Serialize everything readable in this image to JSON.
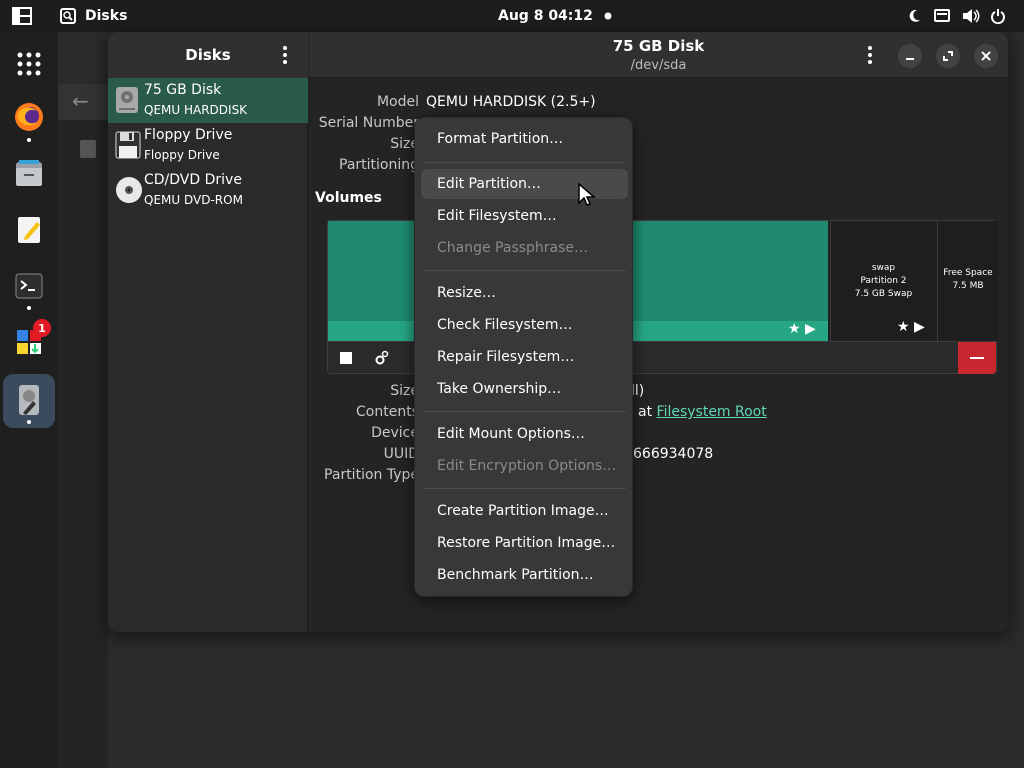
{
  "topbar": {
    "app_name": "Disks",
    "clock": "Aug 8  04:12"
  },
  "dock": {
    "store_badge_count": "1"
  },
  "window": {
    "sidebar": {
      "title": "Disks",
      "drives": [
        {
          "name": "75 GB Disk",
          "sub": "QEMU HARDDISK"
        },
        {
          "name": "Floppy Drive",
          "sub": "Floppy Drive"
        },
        {
          "name": "CD/DVD Drive",
          "sub": "QEMU DVD-ROM"
        }
      ]
    },
    "header": {
      "title": "75 GB Disk",
      "subtitle": "/dev/sda"
    },
    "properties": {
      "model_label": "Model",
      "model_value": "QEMU HARDDISK (2.5+)",
      "serial_label": "Serial Number",
      "size_label": "Size",
      "partitioning_label": "Partitioning"
    },
    "volumes": {
      "heading": "Volumes",
      "swap_name": "swap",
      "swap_part": "Partition 2",
      "swap_desc": "7.5 GB Swap",
      "free_name": "Free Space",
      "free_size": "7.5 MB"
    },
    "details": {
      "size_label": "Size",
      "size_value_tail": "ll)",
      "contents_label": "Contents",
      "contents_value_tail": "at",
      "contents_link": "Filesystem Root",
      "device_label": "Device",
      "uuid_label": "UUID",
      "uuid_value_tail": "666934078",
      "ptype_label": "Partition Type"
    }
  },
  "context_menu": {
    "items": [
      {
        "label": "Format Partition…",
        "disabled": false
      },
      {
        "label": "Edit Partition…",
        "disabled": false
      },
      {
        "label": "Edit Filesystem…",
        "disabled": false
      },
      {
        "label": "Change Passphrase…",
        "disabled": true
      },
      {
        "label": "Resize…",
        "disabled": false
      },
      {
        "label": "Check Filesystem…",
        "disabled": false
      },
      {
        "label": "Repair Filesystem…",
        "disabled": false
      },
      {
        "label": "Take Ownership…",
        "disabled": false
      },
      {
        "label": "Edit Mount Options…",
        "disabled": false
      },
      {
        "label": "Edit Encryption Options…",
        "disabled": true
      },
      {
        "label": "Create Partition Image…",
        "disabled": false
      },
      {
        "label": "Restore Partition Image…",
        "disabled": false
      },
      {
        "label": "Benchmark Partition…",
        "disabled": false
      }
    ]
  },
  "colors": {
    "accent": "#2a5a49",
    "partition_fill": "#1f8a6e",
    "link": "#5fd7b5",
    "danger": "#c7282f"
  }
}
